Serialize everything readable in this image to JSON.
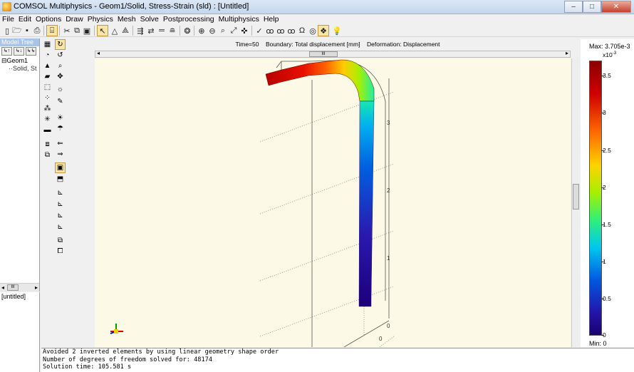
{
  "window": {
    "title": "COMSOL Multiphysics - Geom1/Solid, Stress-Strain (sld) : [Untitled]",
    "buttons": [
      "–",
      "□",
      "✕"
    ]
  },
  "menu": [
    "File",
    "Edit",
    "Options",
    "Draw",
    "Physics",
    "Mesh",
    "Solve",
    "Postprocessing",
    "Multiphysics",
    "Help"
  ],
  "model_tree": {
    "header": "Model Tree",
    "tools": [
      "↳↑",
      "↳↓",
      "↳↳"
    ],
    "root": "Geom1",
    "child": "Solid, St"
  },
  "secondary_panel": {
    "label": "[untitled]"
  },
  "plot": {
    "header_time": "Time=50",
    "header_boundary": "Boundary: Total displacement [mm]",
    "header_deformation": "Deformation: Displacement",
    "axis_ticks": [
      "3",
      "2",
      "1",
      "0"
    ],
    "base_tick": "0"
  },
  "colorbar": {
    "max_label": "Max: 3.705e-3",
    "scale_prefix": "x10",
    "scale_exp": "-3",
    "ticks": [
      "3.5",
      "3",
      "2.5",
      "2",
      "1.5",
      "1",
      "0.5",
      "0"
    ],
    "min_label": "Min: 0"
  },
  "log": {
    "lines": [
      "Avoided 2 inverted elements by using linear geometry shape order",
      "Number of degrees of freedom solved for: 48174",
      "Solution time: 105.581 s"
    ]
  },
  "icons": {
    "toolbar": [
      "new-file-icon",
      "open-icon",
      "save-icon",
      "print-icon",
      "model-navigator-icon",
      "cut-icon",
      "copy-icon",
      "paste-icon",
      "select-icon",
      "triangle-icon",
      "mesh-icon",
      "solve-icon",
      "plot-icon",
      "zoom-in-icon",
      "zoom-out-icon",
      "zoom-window-icon",
      "zoom-extents-icon",
      "help-icon"
    ],
    "scroll_thumb_glyph": "III"
  }
}
